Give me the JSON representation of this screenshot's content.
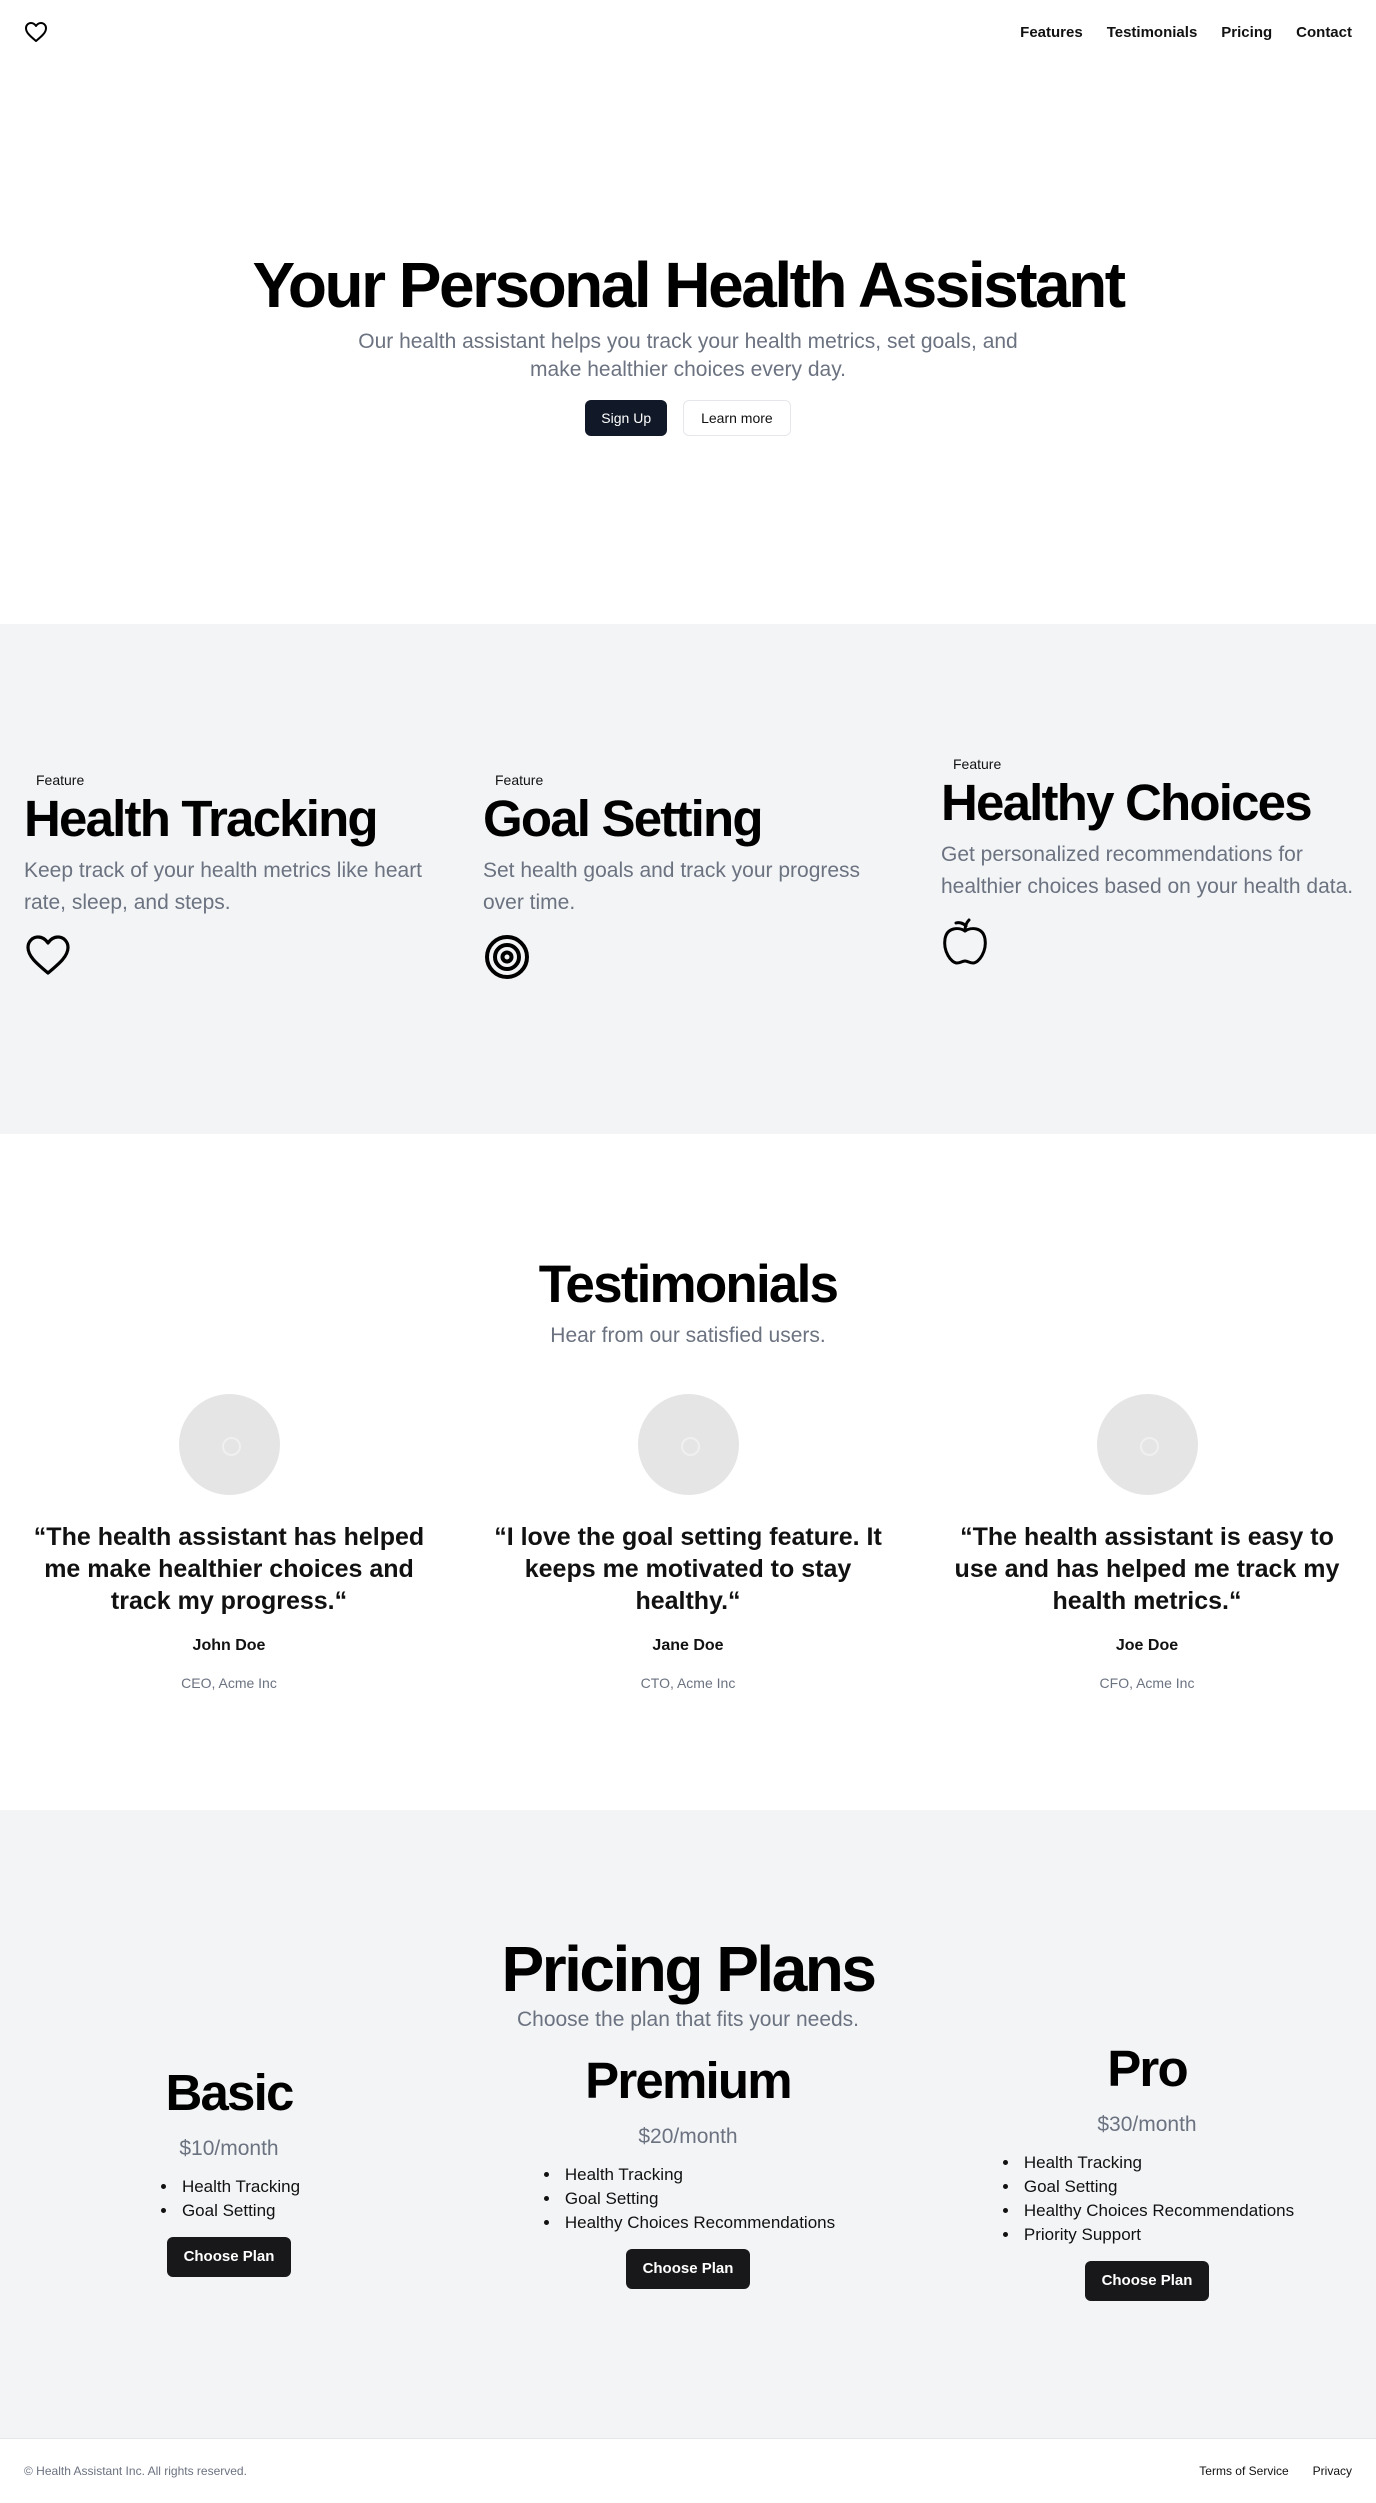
{
  "header": {
    "logo_icon": "heart-icon",
    "nav": [
      "Features",
      "Testimonials",
      "Pricing",
      "Contact"
    ]
  },
  "hero": {
    "title": "Your Personal Health Assistant",
    "subtitle": "Our health assistant helps you track your health metrics, set goals, and make healthier choices every day.",
    "primary_button": "Sign Up",
    "secondary_button": "Learn more"
  },
  "features": [
    {
      "badge": "Feature",
      "title": "Health Tracking",
      "description": "Keep track of your health metrics like heart rate, sleep, and steps.",
      "icon": "heart-icon"
    },
    {
      "badge": "Feature",
      "title": "Goal Setting",
      "description": "Set health goals and track your progress over time.",
      "icon": "target-icon"
    },
    {
      "badge": "Feature",
      "title": "Healthy Choices",
      "description": "Get personalized recommendations for healthier choices based on your health data.",
      "icon": "apple-icon"
    }
  ],
  "testimonials": {
    "title": "Testimonials",
    "subtitle": "Hear from our satisfied users.",
    "items": [
      {
        "quote": "“The health assistant has helped me make healthier choices and track my progress.“",
        "name": "John Doe",
        "role": "CEO, Acme Inc"
      },
      {
        "quote": "“I love the goal setting feature. It keeps me motivated to stay healthy.“",
        "name": "Jane Doe",
        "role": "CTO, Acme Inc"
      },
      {
        "quote": "“The health assistant is easy to use and has helped me track my health metrics.“",
        "name": "Joe Doe",
        "role": "CFO, Acme Inc"
      }
    ]
  },
  "pricing": {
    "title": "Pricing Plans",
    "subtitle": "Choose the plan that fits your needs.",
    "plans": [
      {
        "name": "Basic",
        "price": "$10/month",
        "features": [
          "Health Tracking",
          "Goal Setting"
        ],
        "button": "Choose Plan"
      },
      {
        "name": "Premium",
        "price": "$20/month",
        "features": [
          "Health Tracking",
          "Goal Setting",
          "Healthy Choices Recommendations"
        ],
        "button": "Choose Plan"
      },
      {
        "name": "Pro",
        "price": "$30/month",
        "features": [
          "Health Tracking",
          "Goal Setting",
          "Healthy Choices Recommendations",
          "Priority Support"
        ],
        "button": "Choose Plan"
      }
    ]
  },
  "footer": {
    "copyright": "© Health Assistant Inc. All rights reserved.",
    "links": [
      "Terms of Service",
      "Privacy"
    ]
  }
}
